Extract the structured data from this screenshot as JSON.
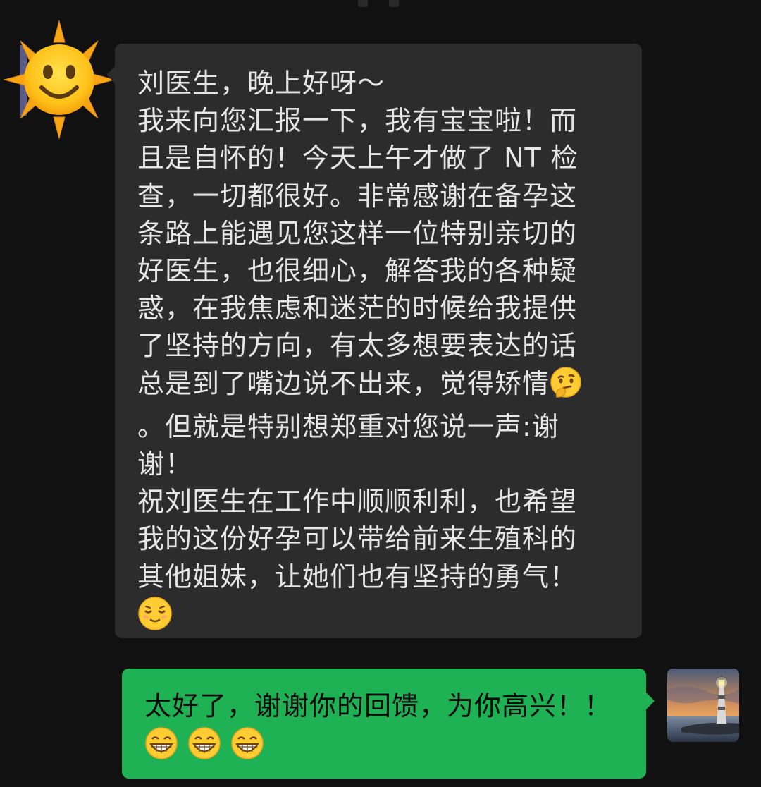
{
  "incoming_message": {
    "lines": [
      "刘医生，晚上好呀～",
      "我来向您汇报一下，我有宝宝啦！而",
      "且是自怀的！今天上午才做了 NT 检",
      "查，一切都很好。非常感谢在备孕这",
      "条路上能遇见您这样一位特别亲切的",
      "好医生，也很细心，解答我的各种疑",
      "惑，在我焦虑和迷茫的时候给我提供",
      "了坚持的方向，有太多想要表达的话",
      "总是到了嘴边说不出来，觉得矫情",
      "。但就是特别想郑重对您说一声:谢",
      "谢！",
      "祝刘医生在工作中顺顺利利，也希望",
      "我的这份好孕可以带给前来生殖科的",
      "其他姐妹，让她们也有坚持的勇气！"
    ],
    "inline_emoji": "thinking-face-emoji",
    "trailing_emoji": "smiling-face-closed-eyes-emoji"
  },
  "reply_message": {
    "text": "太好了，谢谢你的回馈，为你高兴！！",
    "emojis": [
      "grinning-face-emoji",
      "grinning-face-emoji",
      "grinning-face-emoji"
    ]
  },
  "avatars": {
    "sender": "sun-avatar",
    "me": "lighthouse-avatar"
  },
  "colors": {
    "background": "#111111",
    "incoming_bubble": "#2c2c2c",
    "outgoing_bubble": "#1fb254",
    "incoming_text": "#e6e6e6",
    "outgoing_text": "#0b0b0b"
  }
}
